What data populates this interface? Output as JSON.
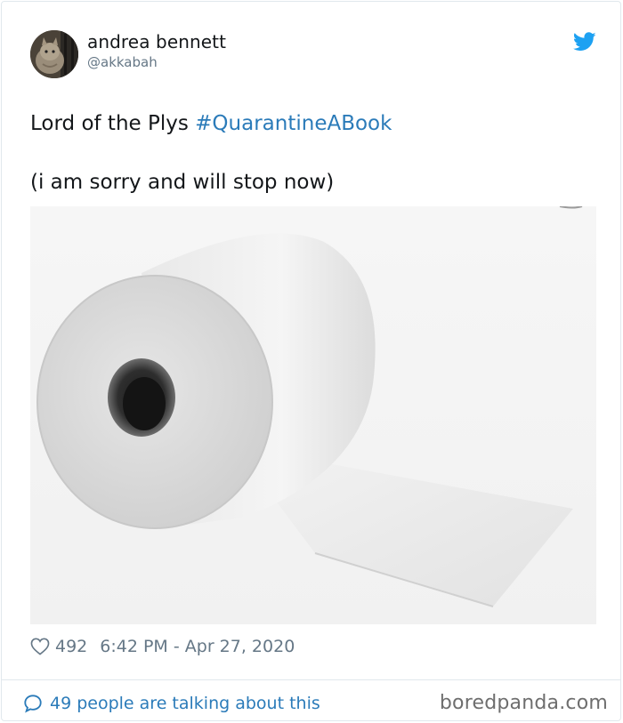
{
  "author": {
    "name": "andrea bennett",
    "handle": "@akkabah"
  },
  "tweet": {
    "text_plain": "Lord of the Plys ",
    "hashtag": "#QuarantineABook",
    "text_line2": "(i am sorry and will stop now)"
  },
  "meta": {
    "likes": "492",
    "timestamp": "6:42 PM - Apr 27, 2020"
  },
  "footer": {
    "talking": "49 people are talking about this",
    "watermark": "boredpanda.com"
  },
  "icons": {
    "brand": "twitter-bird-icon",
    "like": "heart-icon",
    "reply": "speech-bubble-icon"
  },
  "colors": {
    "link": "#2b7bb9",
    "twitter_blue": "#1da1f2",
    "muted": "#657786",
    "text": "#14171a"
  }
}
